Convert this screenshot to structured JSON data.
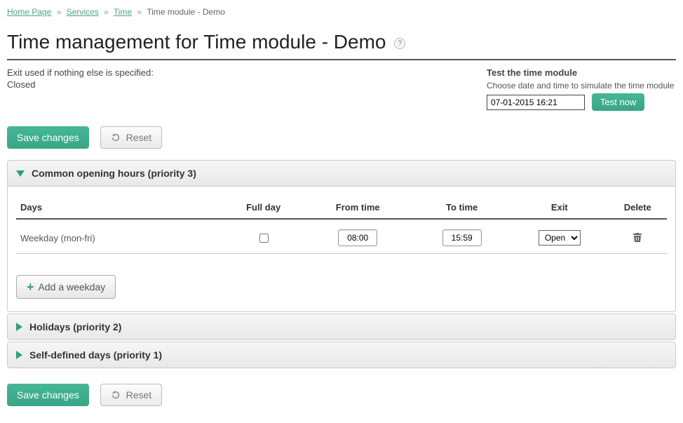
{
  "breadcrumb": {
    "items": [
      {
        "label": "Home Page"
      },
      {
        "label": "Services"
      },
      {
        "label": "Time"
      }
    ],
    "current": "Time module - Demo",
    "sep": "»"
  },
  "page_title": "Time management for Time module - Demo",
  "exit_info": {
    "label": "Exit used if nothing else is specified:",
    "value": "Closed"
  },
  "test": {
    "title": "Test the time module",
    "desc": "Choose date and time to simulate the time module",
    "value": "07-01-2015 16:21",
    "button": "Test now"
  },
  "buttons": {
    "save": "Save changes",
    "reset": "Reset",
    "add_weekday": "Add a weekday"
  },
  "sections": {
    "common": {
      "title": "Common opening hours (priority 3)"
    },
    "holidays": {
      "title": "Holidays (priority 2)"
    },
    "selfdef": {
      "title": "Self-defined days (priority 1)"
    }
  },
  "table": {
    "headers": {
      "days": "Days",
      "full_day": "Full day",
      "from": "From time",
      "to": "To time",
      "exit": "Exit",
      "delete": "Delete"
    },
    "rows": [
      {
        "days": "Weekday (mon-fri)",
        "full_day": false,
        "from": "08:00",
        "to": "15:59",
        "exit": "Open"
      }
    ]
  }
}
